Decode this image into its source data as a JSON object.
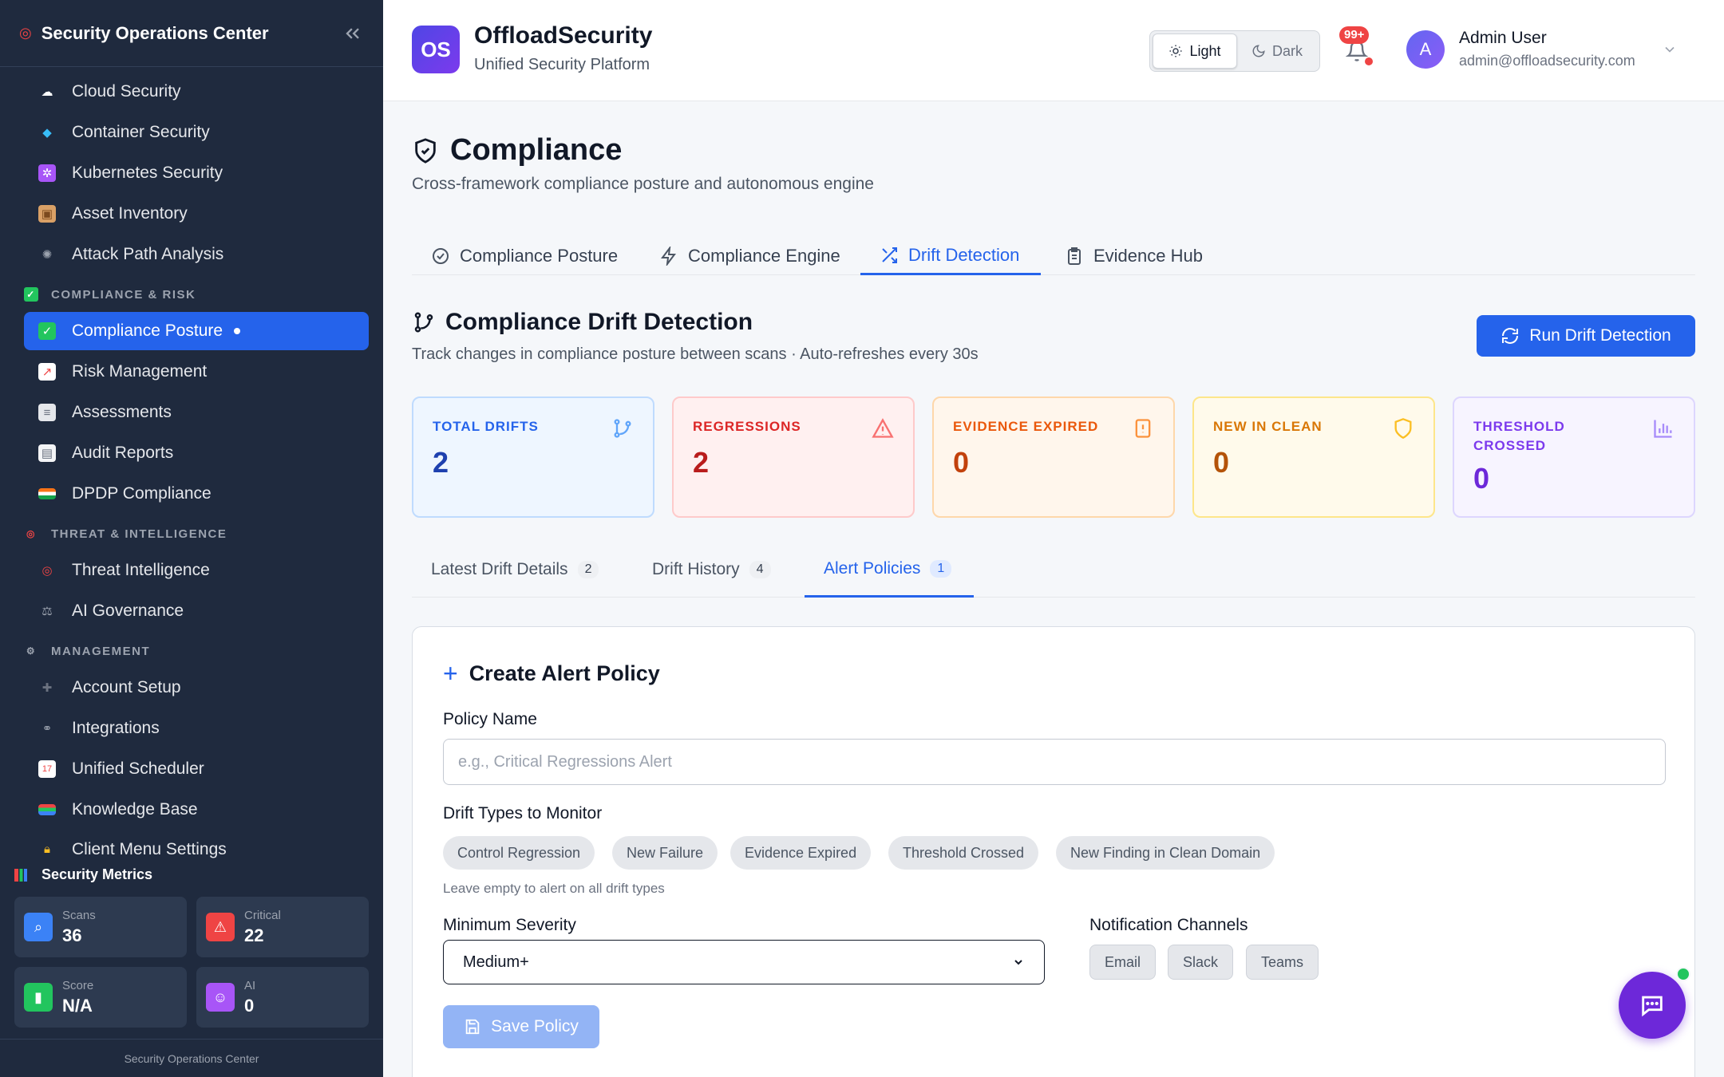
{
  "sidebar": {
    "title": "Security Operations Center",
    "items_top": [
      {
        "label": "Cloud Security",
        "icon": "cloud-icon"
      },
      {
        "label": "Container Security",
        "icon": "whale-icon"
      },
      {
        "label": "Kubernetes Security",
        "icon": "kubernetes-icon"
      },
      {
        "label": "Asset Inventory",
        "icon": "package-icon"
      },
      {
        "label": "Attack Path Analysis",
        "icon": "network-icon"
      }
    ],
    "section_compliance": "COMPLIANCE & RISK",
    "items_compliance": [
      {
        "label": "Compliance Posture",
        "icon": "check-icon"
      },
      {
        "label": "Risk Management",
        "icon": "chart-icon"
      },
      {
        "label": "Assessments",
        "icon": "clipboard-icon"
      },
      {
        "label": "Audit Reports",
        "icon": "document-icon"
      },
      {
        "label": "DPDP Compliance",
        "icon": "india-flag-icon"
      }
    ],
    "section_threat": "THREAT & INTELLIGENCE",
    "items_threat": [
      {
        "label": "Threat Intelligence",
        "icon": "target-icon"
      },
      {
        "label": "AI Governance",
        "icon": "scales-icon"
      }
    ],
    "section_management": "MANAGEMENT",
    "items_management": [
      {
        "label": "Account Setup",
        "icon": "plus-icon"
      },
      {
        "label": "Integrations",
        "icon": "link-icon"
      },
      {
        "label": "Unified Scheduler",
        "icon": "calendar-icon"
      },
      {
        "label": "Knowledge Base",
        "icon": "books-icon"
      },
      {
        "label": "Client Menu Settings",
        "icon": "lock-icon"
      }
    ],
    "metrics_title": "Security Metrics",
    "metrics": [
      {
        "label": "Scans",
        "value": "36",
        "icon": "magnifier-icon"
      },
      {
        "label": "Critical",
        "value": "22",
        "icon": "warning-icon"
      },
      {
        "label": "Score",
        "value": "N/A",
        "icon": "score-icon"
      },
      {
        "label": "AI",
        "value": "0",
        "icon": "robot-icon"
      }
    ],
    "footer": "Security Operations Center"
  },
  "header": {
    "logo": "OS",
    "brand": "OffloadSecurity",
    "tagline": "Unified Security Platform",
    "theme_light": "Light",
    "theme_dark": "Dark",
    "notif_count": "99+",
    "avatar": "A",
    "user_name": "Admin User",
    "user_email": "admin@offloadsecurity.com"
  },
  "page": {
    "title": "Compliance",
    "subtitle": "Cross-framework compliance posture and autonomous engine",
    "tabs": [
      "Compliance Posture",
      "Compliance Engine",
      "Drift Detection",
      "Evidence Hub"
    ]
  },
  "drift": {
    "title": "Compliance Drift Detection",
    "subtitle": "Track changes in compliance posture between scans · Auto-refreshes every 30s",
    "run_button": "Run Drift Detection",
    "cards": [
      {
        "label": "TOTAL DRIFTS",
        "value": "2"
      },
      {
        "label": "REGRESSIONS",
        "value": "2"
      },
      {
        "label": "EVIDENCE EXPIRED",
        "value": "0"
      },
      {
        "label": "NEW IN CLEAN",
        "value": "0"
      },
      {
        "label": "THRESHOLD CROSSED",
        "value": "0"
      }
    ],
    "subtabs": [
      {
        "label": "Latest Drift Details",
        "count": "2"
      },
      {
        "label": "Drift History",
        "count": "4"
      },
      {
        "label": "Alert Policies",
        "count": "1"
      }
    ]
  },
  "policy_form": {
    "title": "Create Alert Policy",
    "name_label": "Policy Name",
    "name_placeholder": "e.g., Critical Regressions Alert",
    "types_label": "Drift Types to Monitor",
    "types": [
      "Control Regression",
      "New Failure",
      "Evidence Expired",
      "Threshold Crossed",
      "New Finding in Clean Domain"
    ],
    "types_hint": "Leave empty to alert on all drift types",
    "severity_label": "Minimum Severity",
    "severity_value": "Medium+",
    "channels_label": "Notification Channels",
    "channels": [
      "Email",
      "Slack",
      "Teams"
    ],
    "save_button": "Save Policy"
  },
  "colors": {
    "primary": "#2563eb",
    "sidebar_bg": "#1f2a3e",
    "total_drifts": "#1e40af",
    "regressions": "#b91c1c",
    "evidence_expired": "#c2410c",
    "new_in_clean": "#b45309",
    "threshold": "#6d28d9"
  }
}
